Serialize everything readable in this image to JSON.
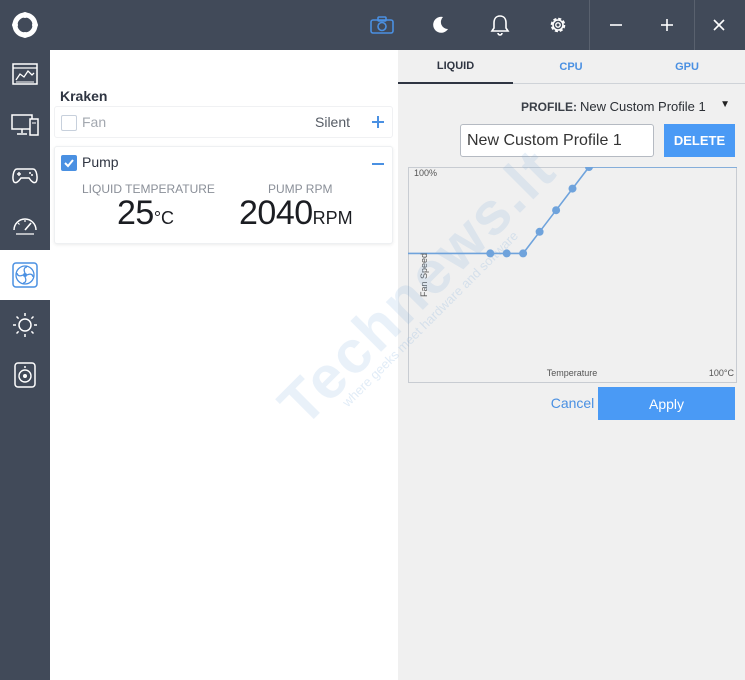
{
  "titlebar": {
    "icons": [
      "logo-icon",
      "camera-icon",
      "moon-icon",
      "bell-icon",
      "gear-icon",
      "minimize-icon",
      "maximize-icon",
      "close-icon"
    ],
    "accent": "#4a90e2"
  },
  "sidebar": {
    "items": [
      {
        "name": "dashboard",
        "icon": "dashboard-icon"
      },
      {
        "name": "pc",
        "icon": "monitor-icon"
      },
      {
        "name": "games",
        "icon": "gamepad-icon"
      },
      {
        "name": "tuning",
        "icon": "gauge-icon"
      },
      {
        "name": "cooling",
        "icon": "fan-icon",
        "active": true
      },
      {
        "name": "lighting",
        "icon": "sun-icon"
      },
      {
        "name": "audio",
        "icon": "speaker-icon"
      }
    ]
  },
  "device": {
    "title": "Kraken",
    "fan": {
      "label": "Fan",
      "checked": false,
      "mode": "Silent"
    },
    "pump": {
      "label": "Pump",
      "checked": true,
      "liquid_temp_label": "LIQUID TEMPERATURE",
      "liquid_temp_value": "25",
      "liquid_temp_unit": "°C",
      "rpm_label": "PUMP RPM",
      "rpm_value": "2040",
      "rpm_unit": "RPM"
    }
  },
  "tabs": [
    "LIQUID",
    "CPU",
    "GPU"
  ],
  "active_tab": "LIQUID",
  "profile": {
    "label": "PROFILE:",
    "selected": "New Custom Profile 1",
    "name_value": "New Custom Profile 1",
    "delete_label": "DELETE"
  },
  "graph": {
    "y_max_label": "100%",
    "y_axis_label": "Fan Speed",
    "x_axis_label": "Temperature",
    "x_max_label": "100°C"
  },
  "chart_data": {
    "type": "line",
    "xlim": [
      0,
      100
    ],
    "ylim": [
      0,
      100
    ],
    "x": [
      0,
      25,
      30,
      35,
      40,
      45,
      50,
      55,
      100
    ],
    "y": [
      60,
      60,
      60,
      60,
      70,
      80,
      90,
      100,
      100
    ],
    "line_color": "#6fa3dc"
  },
  "actions": {
    "cancel_label": "Cancel",
    "apply_label": "Apply"
  },
  "watermark": {
    "big": "Technews.lt",
    "small": "where geeks meet hardware and software"
  }
}
